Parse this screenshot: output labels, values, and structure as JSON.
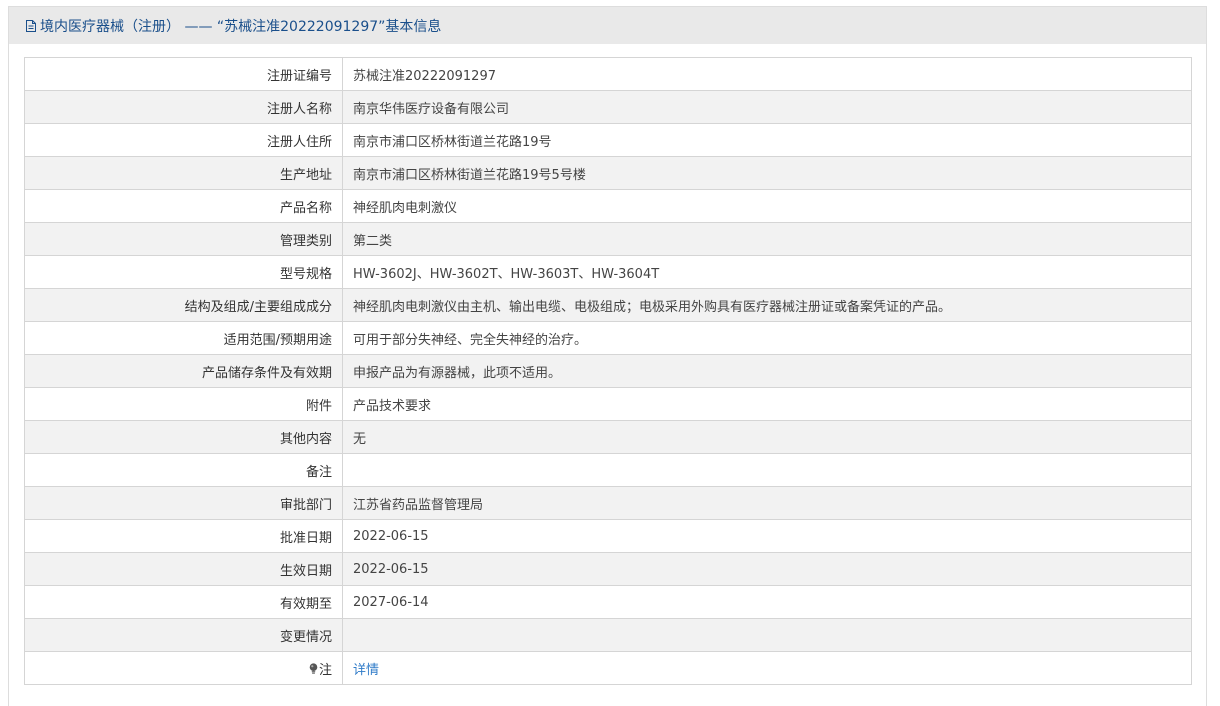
{
  "header": {
    "title": "境内医疗器械（注册） —— “苏械注准20222091297”基本信息"
  },
  "rows": [
    {
      "label": "注册证编号",
      "value": "苏械注准20222091297"
    },
    {
      "label": "注册人名称",
      "value": "南京华伟医疗设备有限公司"
    },
    {
      "label": "注册人住所",
      "value": "南京市浦口区桥林街道兰花路19号"
    },
    {
      "label": "生产地址",
      "value": "南京市浦口区桥林街道兰花路19号5号楼"
    },
    {
      "label": "产品名称",
      "value": "神经肌肉电刺激仪"
    },
    {
      "label": "管理类别",
      "value": "第二类"
    },
    {
      "label": "型号规格",
      "value": "HW-3602J、HW-3602T、HW-3603T、HW-3604T"
    },
    {
      "label": "结构及组成/主要组成成分",
      "value": "神经肌肉电刺激仪由主机、输出电缆、电极组成；电极采用外购具有医疗器械注册证或备案凭证的产品。"
    },
    {
      "label": "适用范围/预期用途",
      "value": "可用于部分失神经、完全失神经的治疗。"
    },
    {
      "label": "产品储存条件及有效期",
      "value": "申报产品为有源器械，此项不适用。"
    },
    {
      "label": "附件",
      "value": "产品技术要求"
    },
    {
      "label": "其他内容",
      "value": "无"
    },
    {
      "label": "备注",
      "value": ""
    },
    {
      "label": "审批部门",
      "value": "江苏省药品监督管理局"
    },
    {
      "label": "批准日期",
      "value": "2022-06-15"
    },
    {
      "label": "生效日期",
      "value": "2022-06-15"
    },
    {
      "label": "有效期至",
      "value": "2027-06-14"
    },
    {
      "label": "变更情况",
      "value": ""
    }
  ],
  "note_row": {
    "icon": "lightbulb-icon",
    "label": "注",
    "link_text": "详情"
  },
  "colors": {
    "header_bg": "#e9e9e9",
    "header_text": "#1a4f8b",
    "link": "#2f7bc8",
    "row_alt_bg": "#f2f2f2"
  }
}
